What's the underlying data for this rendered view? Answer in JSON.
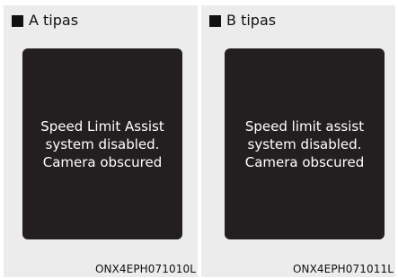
{
  "panels": [
    {
      "title": "A tipas",
      "message_lines": [
        "Speed Limit Assist",
        "system disabled.",
        "Camera obscured"
      ],
      "code": "ONX4EPH071010L"
    },
    {
      "title": "B tipas",
      "message_lines": [
        "Speed limit assist",
        "system disabled.",
        "Camera obscured"
      ],
      "code": "ONX4EPH071011L"
    }
  ],
  "colors": {
    "panel_background": "#ececec",
    "screen_background": "#231f20",
    "screen_text": "#ffffff",
    "square_marker": "#111111"
  }
}
